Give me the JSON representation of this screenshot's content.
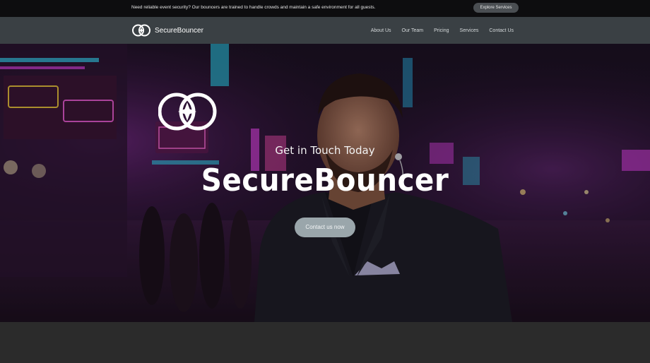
{
  "topbar": {
    "message": "Need reliable event security? Our bouncers are trained to handle crowds and maintain a safe environment for all guests.",
    "button_label": "Explore Services"
  },
  "brand": {
    "name": "SecureBouncer",
    "logo_icon": "securebouncer-logo-icon"
  },
  "nav": {
    "items": [
      {
        "label": "About Us"
      },
      {
        "label": "Our Team"
      },
      {
        "label": "Pricing"
      },
      {
        "label": "Services"
      },
      {
        "label": "Contact Us"
      }
    ]
  },
  "hero": {
    "background": "nightclub-street-bouncer-photo",
    "subtitle": "Get in Touch Today",
    "title": "SecureBouncer",
    "cta_label": "Contact us now"
  },
  "colors": {
    "topbar_bg": "#0d0d0f",
    "navbar_bg": "#3a4044",
    "cta_bg": "#9aa6ab",
    "page_bg": "#2b2b2b",
    "neon_pink": "#d23fd8",
    "neon_cyan": "#35c8e6"
  }
}
